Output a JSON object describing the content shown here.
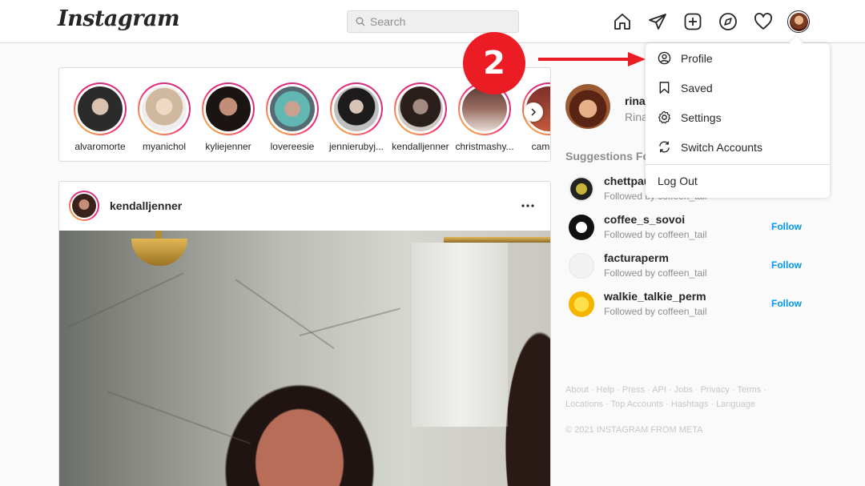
{
  "header": {
    "logo": "Instagram",
    "search_placeholder": "Search",
    "nav_icons": [
      "home-icon",
      "direct-message-icon",
      "new-post-icon",
      "explore-icon",
      "activity-heart-icon",
      "profile-avatar"
    ]
  },
  "stories": [
    {
      "name": "alvaromorte"
    },
    {
      "name": "myanichol"
    },
    {
      "name": "kyliejenner"
    },
    {
      "name": "lovereesie"
    },
    {
      "name": "jennierubyj..."
    },
    {
      "name": "kendalljenner"
    },
    {
      "name": "christmashy..."
    },
    {
      "name": "cambria"
    }
  ],
  "post": {
    "username": "kendalljenner"
  },
  "sidebar": {
    "username": "rina_",
    "fullname": "Rina",
    "suggestions_title": "Suggestions For",
    "suggestions": [
      {
        "username": "chettpau",
        "subtitle": "Followed by coffeen_tail",
        "action": ""
      },
      {
        "username": "coffee_s_sovoi",
        "subtitle": "Followed by coffeen_tail",
        "action": "Follow"
      },
      {
        "username": "facturaperm",
        "subtitle": "Followed by coffeen_tail",
        "action": "Follow"
      },
      {
        "username": "walkie_talkie_perm",
        "subtitle": "Followed by coffeen_tail",
        "action": "Follow"
      }
    ],
    "footer_links": "About · Help · Press · API · Jobs · Privacy · Terms · Locations · Top Accounts · Hashtags · Language",
    "copyright": "© 2021 INSTAGRAM FROM META"
  },
  "dropdown": {
    "items": [
      "Profile",
      "Saved",
      "Settings",
      "Switch Accounts"
    ],
    "logout": "Log Out"
  },
  "annotation": {
    "step_number": "2",
    "color": "#ec1c24"
  }
}
